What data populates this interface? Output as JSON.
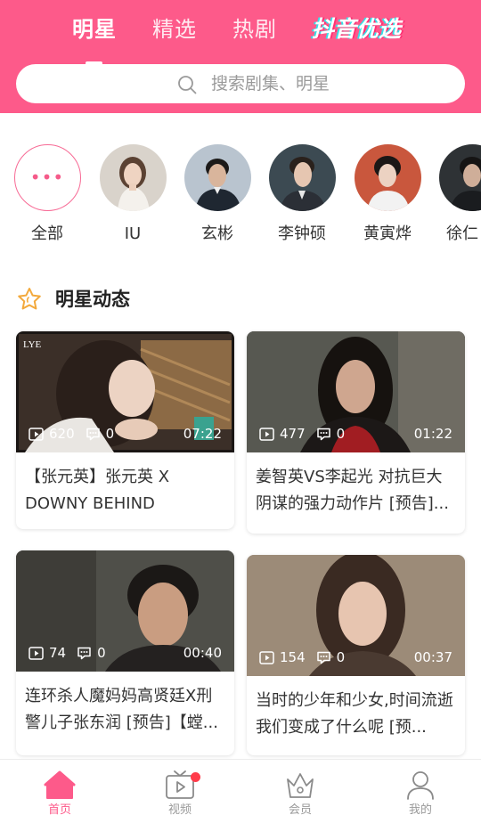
{
  "colors": {
    "brand": "#fd5a8a",
    "text_primary": "#333333",
    "text_muted": "#9a9a9a",
    "badge_red": "#ff3b4a"
  },
  "header": {
    "tabs": [
      {
        "label": "明星",
        "active": true
      },
      {
        "label": "精选",
        "active": false
      },
      {
        "label": "热剧",
        "active": false
      }
    ],
    "logo_text": "抖音优选",
    "search": {
      "placeholder": "搜索剧集、明星",
      "icon": "search-icon"
    }
  },
  "stars": {
    "all_label": "全部",
    "all_icon": "more-dots-icon",
    "items": [
      {
        "name": "IU"
      },
      {
        "name": "玄彬"
      },
      {
        "name": "李钟硕"
      },
      {
        "name": "黄寅烨"
      },
      {
        "name": "徐仁"
      }
    ]
  },
  "section": {
    "title": "明星动态",
    "icon": "star-outline-icon"
  },
  "videos": [
    {
      "views": "620",
      "comments": "0",
      "duration": "07:22",
      "title": "【张元英】张元英 X DOWNY BEHIND"
    },
    {
      "views": "477",
      "comments": "0",
      "duration": "01:22",
      "title": "姜智英VS李起光 对抗巨大阴谋的强力动作片 [预告]..."
    },
    {
      "views": "74",
      "comments": "0",
      "duration": "00:40",
      "title": "连环杀人魔妈妈高贤廷X刑警儿子张东润 [预告]【螳..."
    },
    {
      "views": "154",
      "comments": "0",
      "duration": "00:37",
      "title": "当时的少年和少女,时间流逝 我们变成了什么呢 [预..."
    }
  ],
  "bottom_nav": [
    {
      "label": "首页",
      "icon": "home-icon",
      "active": true
    },
    {
      "label": "视频",
      "icon": "tv-play-icon",
      "active": false,
      "badge": true
    },
    {
      "label": "会员",
      "icon": "crown-icon",
      "active": false
    },
    {
      "label": "我的",
      "icon": "user-icon",
      "active": false
    }
  ]
}
